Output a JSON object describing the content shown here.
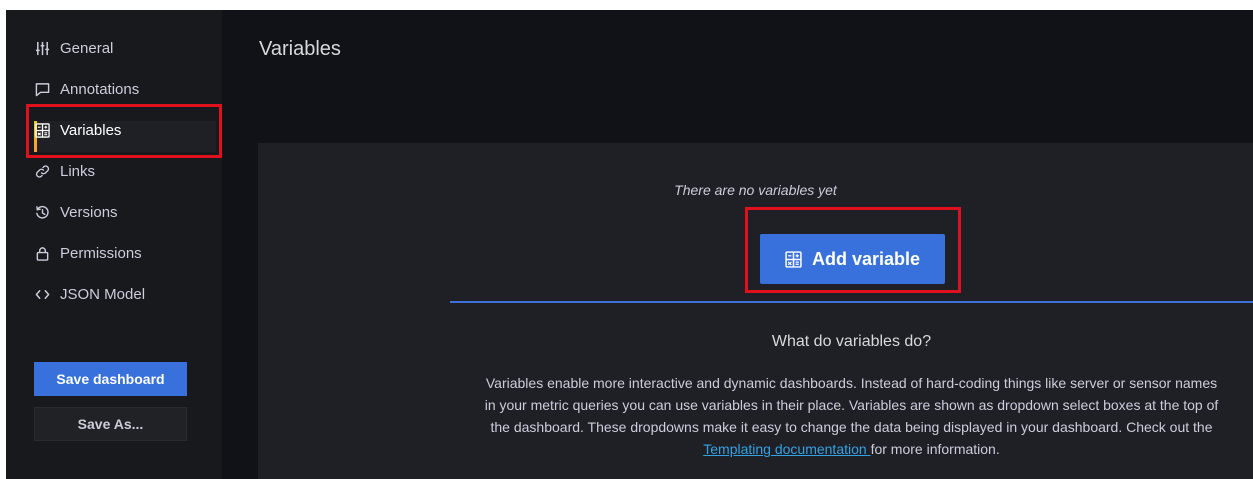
{
  "sidebar": {
    "items": [
      {
        "label": "General",
        "icon": "sliders-icon"
      },
      {
        "label": "Annotations",
        "icon": "comment-icon"
      },
      {
        "label": "Variables",
        "icon": "calculator-icon",
        "active": true
      },
      {
        "label": "Links",
        "icon": "link-icon"
      },
      {
        "label": "Versions",
        "icon": "history-icon"
      },
      {
        "label": "Permissions",
        "icon": "lock-icon"
      },
      {
        "label": "JSON Model",
        "icon": "code-icon"
      }
    ],
    "save_label": "Save dashboard",
    "save_as_label": "Save As..."
  },
  "main": {
    "title": "Variables",
    "empty_text": "There are no variables yet",
    "add_label": "Add variable",
    "help_heading": "What do variables do?",
    "help_text_before": "Variables enable more interactive and dynamic dashboards. Instead of hard-coding things like server or sensor names in your metric queries you can use variables in their place. Variables are shown as dropdown select boxes at the top of the dashboard. These dropdowns make it easy to change the data being displayed in your dashboard. Check out the ",
    "help_link": "Templating documentation ",
    "help_text_after": "for more information."
  },
  "colors": {
    "primary": "#3871dc",
    "highlight_box": "#e0101c",
    "link": "#33a2e5",
    "active_indicator": "#f2cc0c"
  }
}
